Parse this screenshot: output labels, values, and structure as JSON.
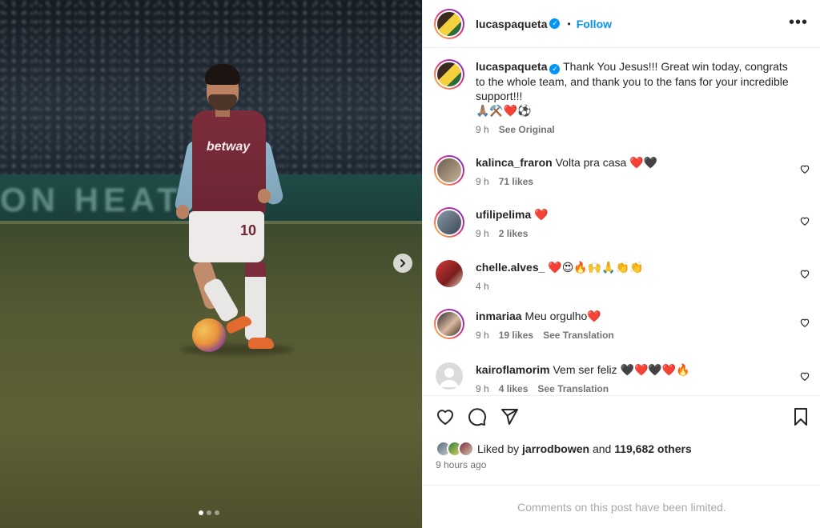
{
  "post": {
    "username": "lucaspaqueta",
    "follow_label": "Follow",
    "separator": "•",
    "more_icon": "•••",
    "sponsor_text": "betway",
    "shirt_number": "10",
    "board_text": "ON HEAT",
    "carousel": {
      "current": 1,
      "total": 3
    }
  },
  "caption": {
    "username": "lucaspaqueta",
    "text": "Thank You Jesus!!! Great win today, congrats to the whole team, and thank you to the fans for your incredible support!!!",
    "emojis": "🙏🏽⚒️❤️⚽",
    "time": "9 h",
    "see_original": "See Original"
  },
  "comments": [
    {
      "username": "kalinca_fraron",
      "text": "Volta pra casa ❤️🖤",
      "time": "9 h",
      "likes": "71 likes",
      "translation": ""
    },
    {
      "username": "ufilipelima",
      "text": "❤️",
      "time": "9 h",
      "likes": "2 likes",
      "translation": ""
    },
    {
      "username": "chelle.alves_",
      "text": "❤️😍🔥🙌🙏👏👏",
      "time": "4 h",
      "likes": "",
      "translation": ""
    },
    {
      "username": "inmariaa",
      "text": "Meu orgulho❤️",
      "time": "9 h",
      "likes": "19 likes",
      "translation": "See Translation"
    },
    {
      "username": "kairoflamorim",
      "text": "Vem ser feliz 🖤❤️🖤❤️🔥",
      "time": "9 h",
      "likes": "4 likes",
      "translation": "See Translation"
    }
  ],
  "likes": {
    "prefix": "Liked by",
    "user": "jarrodbowen",
    "conjunction": "and",
    "others": "119,682 others"
  },
  "time_ago": "9 hours ago",
  "comments_limited": "Comments on this post have been limited.",
  "colors": {
    "accent": "#0095f6",
    "secondary_text": "#737373",
    "shirt": "#7b2d3b"
  }
}
